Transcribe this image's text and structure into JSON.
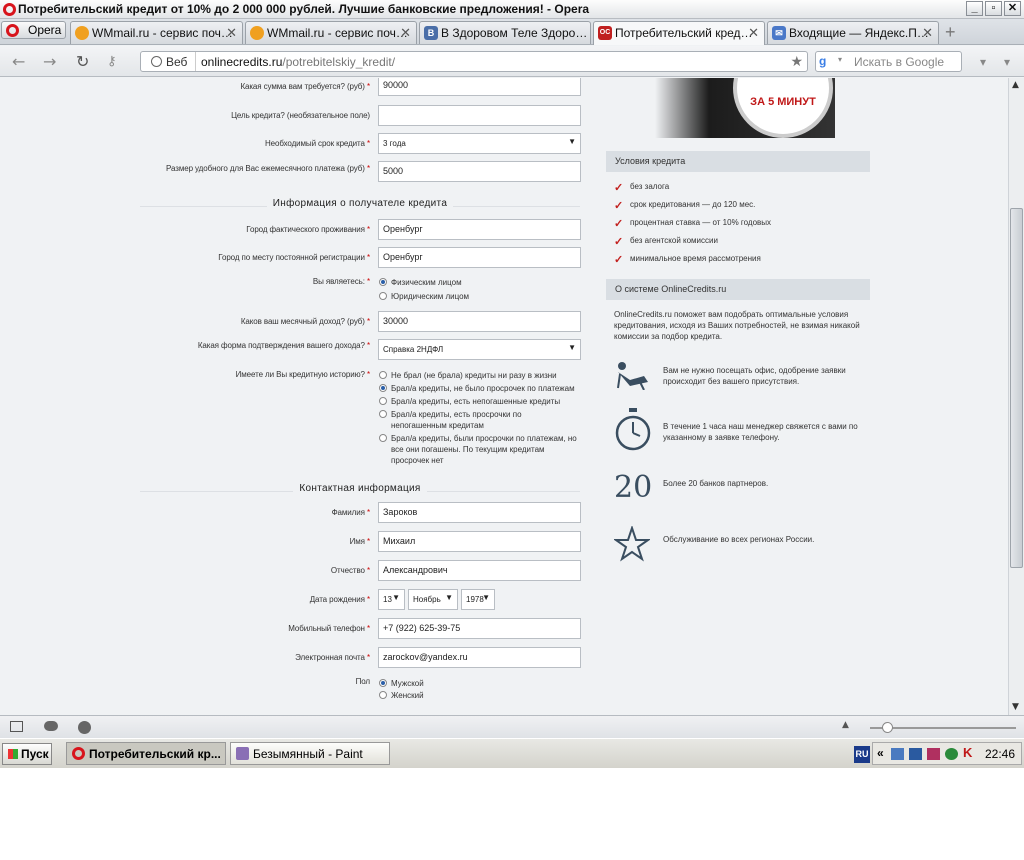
{
  "window": {
    "title": "Потребительский кредит от 10% до 2 000 000 рублей. Лучшие банковские предложения! - Opera"
  },
  "tabs": {
    "menu_label": "Opera",
    "items": [
      {
        "label": "WMmail.ru - сервис поч…",
        "color": "#f0a020"
      },
      {
        "label": "WMmail.ru - сервис поч…",
        "color": "#f0a020"
      },
      {
        "label": "В Здоровом Теле Здоро…",
        "color": "#4a6ea8",
        "icon_text": "В"
      },
      {
        "label": "Потребительский кред…",
        "color": "#c02020",
        "icon_text": "OC"
      },
      {
        "label": "Входящие — Яндекс.П…",
        "color": "#4a78c8"
      }
    ]
  },
  "addressbar": {
    "web_label": "Веб",
    "domain": "onlinecredits.ru",
    "path": "/potrebitelskiy_kredit/",
    "search_placeholder": "Искать в Google"
  },
  "form": {
    "amount_label": "Какая сумма вам требуется? (руб)",
    "amount_value": "90000",
    "purpose_label": "Цель кредита? (необязательное поле)",
    "purpose_value": "",
    "term_label": "Необходимый срок кредита",
    "term_value": "3 года",
    "payment_label": "Размер удобного для Вас ежемесячного платежа (руб)",
    "payment_value": "5000",
    "section_borrower": "Информация о получателе кредита",
    "city_actual_label": "Город фактического проживания",
    "city_actual_value": "Оренбург",
    "city_reg_label": "Город по месту постоянной регистрации",
    "city_reg_value": "Оренбург",
    "you_are_label": "Вы являетесь:",
    "you_are_options": [
      "Физическим лицом",
      "Юридическим лицом"
    ],
    "income_label": "Каков ваш месячный доход? (руб)",
    "income_value": "30000",
    "income_proof_label": "Какая форма подтверждения вашего дохода?",
    "income_proof_value": "Справка 2НДФЛ",
    "history_label": "Имеете ли Вы кредитную историю?",
    "history_options": [
      "Не брал (не брала) кредиты ни разу в жизни",
      "Брал/а кредиты, не было просрочек по платежам",
      "Брал/а кредиты, есть непогашенные кредиты",
      "Брал/а кредиты, есть просрочки по непогашенным кредитам",
      "Брал/а кредиты, были просрочки по платежам, но все они погашены. По текущим кредитам просрочек нет"
    ],
    "section_contact": "Контактная информация",
    "surname_label": "Фамилия",
    "surname_value": "Зароков",
    "name_label": "Имя",
    "name_value": "Михаил",
    "patronymic_label": "Отчество",
    "patronymic_value": "Александрович",
    "birth_label": "Дата рождения",
    "birth_day": "13",
    "birth_month": "Ноябрь",
    "birth_year": "1978",
    "phone_label": "Мобильный телефон",
    "phone_value": "+7 (922) 625-39-75",
    "email_label": "Электронная почта",
    "email_value": "zarockov@yandex.ru",
    "gender_label": "Пол",
    "gender_options": [
      "Мужской",
      "Женский"
    ]
  },
  "sidebar": {
    "promo_text": "ЗА 5 МИНУТ",
    "conditions_title": "Условия кредита",
    "conditions": [
      "без залога",
      "срок кредитования — до 120 мес.",
      "процентная ставка — от 10% годовых",
      "без агентской комиссии",
      "минимальное время рассмотрения"
    ],
    "about_title": "О системе OnlineCredits.ru",
    "about_text": "OnlineCredits.ru поможет вам подобрать оптимальные условия кредитования, исходя из Ваших потребностей, не взимая никакой комиссии за подбор кредита.",
    "features": [
      {
        "icon": "relax-chair-icon",
        "text": "Вам не нужно посещать офис, одобрение заявки происходит без вашего присутствия."
      },
      {
        "icon": "stopwatch-icon",
        "text": "В течение 1 часа наш менеджер свяжется с вами по указанному в заявке телефону."
      },
      {
        "icon": "number-20-icon",
        "big": "20",
        "text": "Более 20 банков партнеров."
      },
      {
        "icon": "star-icon",
        "text": "Обслуживание во всех регионах России."
      }
    ]
  },
  "taskbar": {
    "start": "Пуск",
    "items": [
      "Потребительский кр...",
      "Безымянный - Paint"
    ],
    "lang": "RU",
    "clock": "22:46"
  }
}
